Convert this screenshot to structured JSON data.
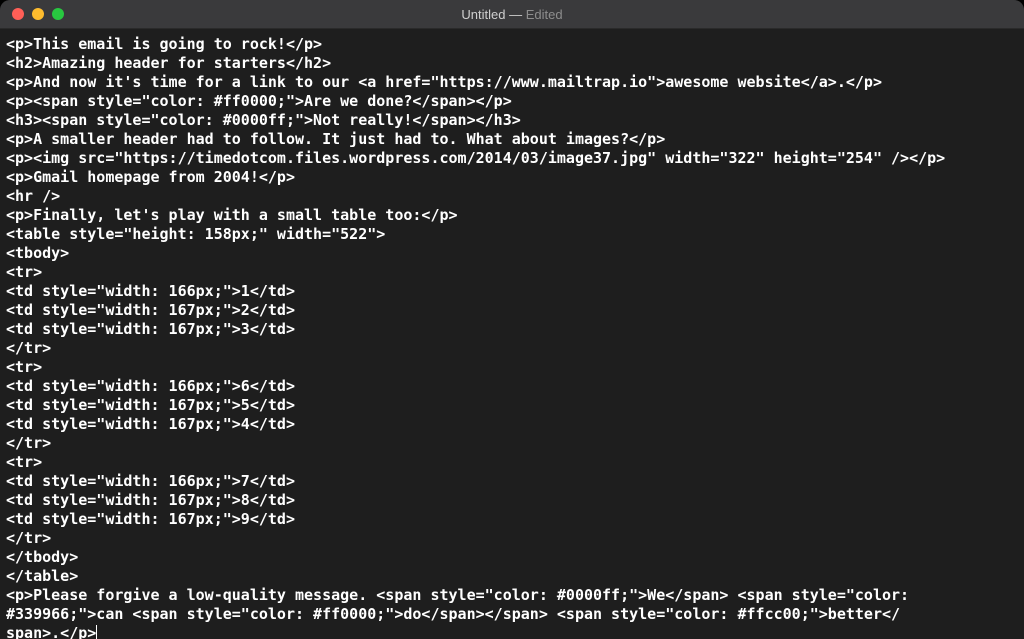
{
  "window": {
    "title_main": "Untitled",
    "title_sep": " — ",
    "title_edited": "Edited"
  },
  "code_lines": [
    "<p>This email is going to rock!</p>",
    "<h2>Amazing header for starters</h2>",
    "<p>And now it's time for a link to our <a href=\"https://www.mailtrap.io\">awesome website</a>.</p>",
    "<p><span style=\"color: #ff0000;\">Are we done?</span></p>",
    "<h3><span style=\"color: #0000ff;\">Not really!</span></h3>",
    "<p>A smaller header had to follow. It just had to. What about images?</p>",
    "<p><img src=\"https://timedotcom.files.wordpress.com/2014/03/image37.jpg\" width=\"322\" height=\"254\" /></p>",
    "<p>Gmail homepage from 2004!</p>",
    "<hr />",
    "<p>Finally, let's play with a small table too:</p>",
    "<table style=\"height: 158px;\" width=\"522\">",
    "<tbody>",
    "<tr>",
    "<td style=\"width: 166px;\">1</td>",
    "<td style=\"width: 167px;\">2</td>",
    "<td style=\"width: 167px;\">3</td>",
    "</tr>",
    "<tr>",
    "<td style=\"width: 166px;\">6</td>",
    "<td style=\"width: 167px;\">5</td>",
    "<td style=\"width: 167px;\">4</td>",
    "</tr>",
    "<tr>",
    "<td style=\"width: 166px;\">7</td>",
    "<td style=\"width: 167px;\">8</td>",
    "<td style=\"width: 167px;\">9</td>",
    "</tr>",
    "</tbody>",
    "</table>",
    "<p>Please forgive a low-quality message. <span style=\"color: #0000ff;\">We</span> <span style=\"color: #339966;\">can <span style=\"color: #ff0000;\">do</span></span> <span style=\"color: #ffcc00;\">better</span>.</p>"
  ]
}
